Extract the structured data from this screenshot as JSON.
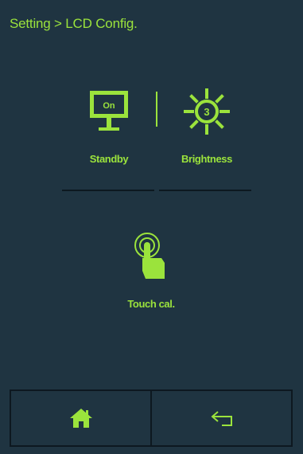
{
  "header": {
    "breadcrumb": "Setting > LCD Config."
  },
  "standby": {
    "label": "Standby",
    "monitor_text": "On"
  },
  "brightness": {
    "label": "Brightness",
    "level": "3"
  },
  "touch_cal": {
    "label": "Touch cal."
  },
  "colors": {
    "background": "#1f3441",
    "accent": "#9be33c",
    "line": "#0d1820"
  },
  "icons": {
    "standby": "monitor-icon",
    "brightness": "sun-icon",
    "touch": "touch-finger-icon",
    "home": "home-icon",
    "back": "back-arrow-icon"
  }
}
